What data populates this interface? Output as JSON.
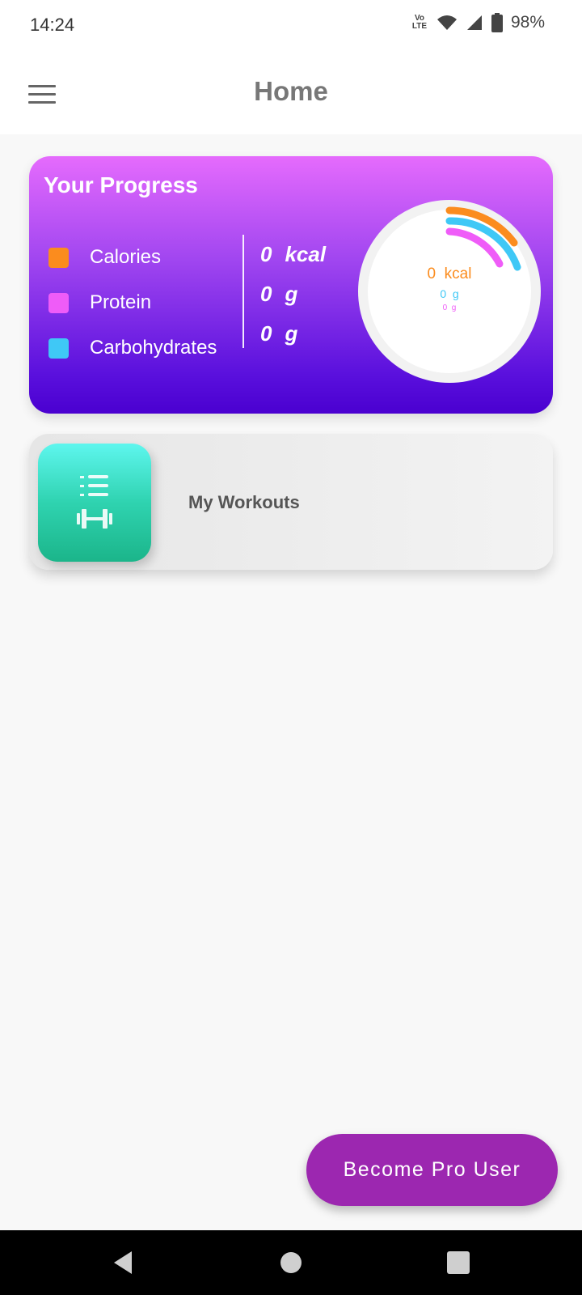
{
  "status_bar": {
    "time": "14:24",
    "network": "Vo LTE",
    "battery_percent": "98%",
    "icons": [
      "volte-icon",
      "wifi-icon",
      "signal-icon",
      "battery-icon"
    ]
  },
  "app_bar": {
    "title": "Home",
    "menu_icon": "hamburger-menu-icon"
  },
  "progress": {
    "title": "Your Progress",
    "items": [
      {
        "label": "Calories",
        "color": "#fb8c1e",
        "value": "0",
        "unit": "kcal"
      },
      {
        "label": "Protein",
        "color": "#ef5cf8",
        "value": "0",
        "unit": "g"
      },
      {
        "label": "Carbohydrates",
        "color": "#3fc8f6",
        "value": "0",
        "unit": "g"
      }
    ],
    "ring": {
      "calories_text": "0  kcal",
      "carbs_text": "0  g",
      "protein_text": "0  g"
    }
  },
  "workouts": {
    "label": "My Workouts",
    "icon": "workout-list-dumbbell-icon"
  },
  "pro_button": {
    "label": "Become Pro User",
    "color": "#9c27b0"
  },
  "nav": {
    "back_icon": "back-triangle-icon",
    "home_icon": "home-circle-icon",
    "recents_icon": "recents-square-icon"
  }
}
